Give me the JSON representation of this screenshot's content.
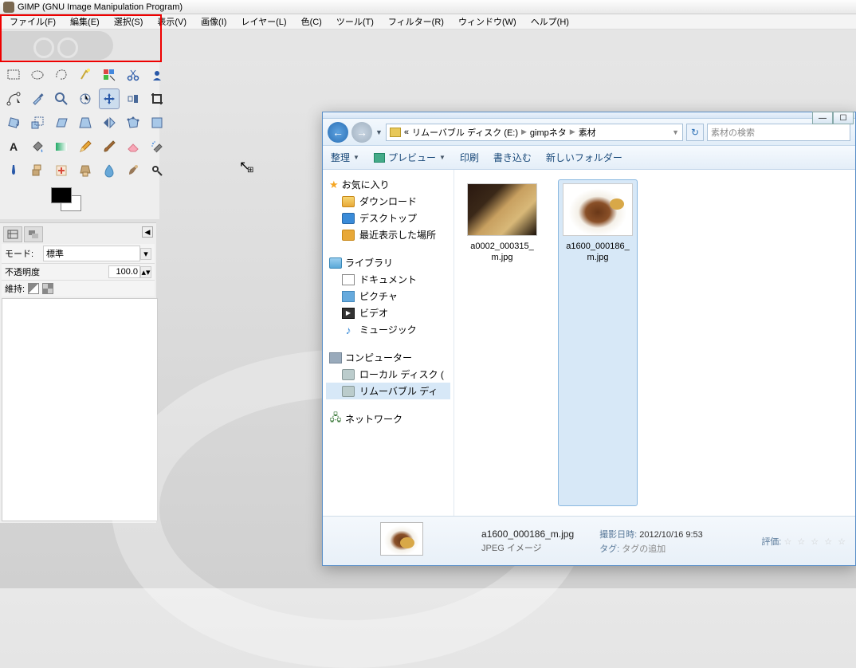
{
  "title": "GIMP (GNU Image Manipulation Program)",
  "menu": {
    "file": "ファイル(F)",
    "edit": "編集(E)",
    "select": "選択(S)",
    "view": "表示(V)",
    "image": "画像(I)",
    "layer": "レイヤー(L)",
    "color": "色(C)",
    "tool": "ツール(T)",
    "filter": "フィルター(R)",
    "window": "ウィンドウ(W)",
    "help": "ヘルプ(H)"
  },
  "options": {
    "mode_label": "モード:",
    "mode_value": "標準",
    "opacity_label": "不透明度",
    "opacity_value": "100.0",
    "preserve_label": "維持:"
  },
  "explorer": {
    "breadcrumb": {
      "pre": "«",
      "disk": "リムーバブル ディスク (E:)",
      "folder1": "gimpネタ",
      "folder2": "素材"
    },
    "search_placeholder": "素材の検索",
    "toolbar": {
      "organize": "整理",
      "preview": "プレビュー",
      "print": "印刷",
      "burn": "書き込む",
      "newfolder": "新しいフォルダー"
    },
    "tree": {
      "favorites": "お気に入り",
      "downloads": "ダウンロード",
      "desktop": "デスクトップ",
      "recent": "最近表示した場所",
      "library": "ライブラリ",
      "documents": "ドキュメント",
      "pictures": "ピクチャ",
      "videos": "ビデオ",
      "music": "ミュージック",
      "computer": "コンピューター",
      "localdisk": "ローカル ディスク (",
      "removable": "リムーバブル ディ",
      "network": "ネットワーク"
    },
    "files": [
      {
        "name": "a0002_000315_m.jpg"
      },
      {
        "name": "a1600_000186_m.jpg"
      }
    ],
    "details": {
      "name": "a1600_000186_m.jpg",
      "type": "JPEG イメージ",
      "date_label": "撮影日時:",
      "date_value": "2012/10/16 9:53",
      "tag_label": "タグ:",
      "tag_value": "タグの追加",
      "rating_label": "評価:"
    }
  }
}
